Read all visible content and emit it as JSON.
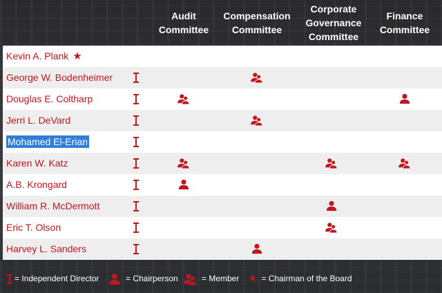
{
  "columns": [
    {
      "label": "Audit\nCommittee"
    },
    {
      "label": "Compensation\nCommittee"
    },
    {
      "label": "Corporate\nGovernance\nCommittee"
    },
    {
      "label": "Finance\nCommittee"
    }
  ],
  "directors": [
    {
      "name": "Kevin A. Plank",
      "chairman": true,
      "independent": false,
      "committees": [
        "",
        "",
        "",
        ""
      ]
    },
    {
      "name": "George W. Bodenheimer",
      "chairman": false,
      "independent": true,
      "committees": [
        "",
        "member",
        "",
        ""
      ]
    },
    {
      "name": "Douglas E. Coltharp",
      "chairman": false,
      "independent": true,
      "committees": [
        "member",
        "",
        "",
        "chairperson"
      ]
    },
    {
      "name": "Jerri L. DeVard",
      "chairman": false,
      "independent": true,
      "committees": [
        "",
        "member",
        "",
        ""
      ]
    },
    {
      "name": "Mohamed El-Erian",
      "chairman": false,
      "independent": true,
      "selected": true,
      "committees": [
        "",
        "",
        "",
        ""
      ]
    },
    {
      "name": "Karen W. Katz",
      "chairman": false,
      "independent": true,
      "committees": [
        "member",
        "",
        "member",
        "member"
      ]
    },
    {
      "name": "A.B. Krongard",
      "chairman": false,
      "independent": true,
      "committees": [
        "chairperson",
        "",
        "",
        ""
      ]
    },
    {
      "name": "William R. McDermott",
      "chairman": false,
      "independent": true,
      "committees": [
        "",
        "",
        "chairperson",
        ""
      ]
    },
    {
      "name": "Eric T. Olson",
      "chairman": false,
      "independent": true,
      "committees": [
        "",
        "",
        "member",
        ""
      ]
    },
    {
      "name": "Harvey L. Sanders",
      "chairman": false,
      "independent": true,
      "committees": [
        "",
        "chairperson",
        "",
        ""
      ]
    }
  ],
  "legend": {
    "independent_label": "= Independent Director",
    "chair_label": "= Chairperson",
    "member_label": "= Member",
    "chairman_label": "= Chairman of the Board"
  },
  "colors": {
    "accent": "#c0161f",
    "selection": "#2f7fd6"
  },
  "icons": {
    "independent": "independent-director-icon",
    "chairperson": "chairperson-icon",
    "member": "member-icon",
    "chairman": "star-icon"
  }
}
